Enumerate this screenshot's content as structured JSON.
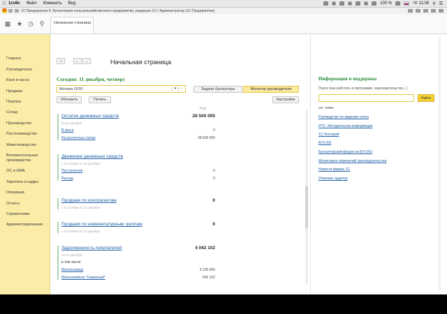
{
  "menubar": {
    "app": "1cv8c",
    "items": [
      "Файл",
      "Изменить",
      "Вид"
    ],
    "battery": "100 %",
    "clock": "Чт 11:08"
  },
  "titlebar": {
    "title": "1С:Предприятие 8. Бухгалтерия сельскохозяйственного предприятия, редакция 3.0 / Администратор (1С:Предприятие)"
  },
  "tab": {
    "label": "Начальная страница"
  },
  "sidebar": {
    "items": [
      "Главное",
      "Руководителю",
      "Банк и касса",
      "Продажи",
      "Покупки",
      "Склад",
      "Производство",
      "Растениеводство",
      "Животноводство",
      "Вспомогательные производства",
      "ОС и НМА",
      "Зарплата и кадры",
      "Операции",
      "Отчеты",
      "Справочники",
      "Администрирование"
    ]
  },
  "main": {
    "page_title": "Начальная страница",
    "today": "Сегодня: 11 декабря, четверг",
    "org": "Молоко ООО",
    "btn_tasks": "Задачи бухгалтера",
    "btn_monitor": "Монитор руководителя",
    "btn_refresh": "Обновить",
    "btn_print": "Печать",
    "btn_settings": "Настройки",
    "col_unit": "Руб",
    "blocks": {
      "cash": {
        "title": "Остатки денежных средств",
        "value": "28 500 000",
        "period": "на 11 декабря",
        "rows": [
          {
            "label": "В кассе",
            "value": "0"
          },
          {
            "label": "На расчетных счетах",
            "value": "28 500 000"
          }
        ]
      },
      "flow": {
        "title": "Движение денежных средств",
        "period": "с 10 ноября по 11 декабря",
        "rows": [
          {
            "label": "Поступления",
            "value": "0"
          },
          {
            "label": "Расход",
            "value": "0"
          }
        ]
      },
      "sales_ctr": {
        "title": "Продажи по контрагентам",
        "value": "0",
        "period": "с 12 ноября по 11 декабря"
      },
      "sales_nom": {
        "title": "Продажи по номенклатурным группам",
        "value": "0",
        "period": "с 12 ноября по 11 декабря"
      },
      "debt": {
        "title": "Задолженность покупателей",
        "value": "4 042 102",
        "period": "на 11 декабря",
        "sub": "в том числе",
        "rows": [
          {
            "label": "Молокозавод",
            "value": "3 100 000"
          },
          {
            "label": "Мясокомбинат \"Камерный\"",
            "value": "942 102"
          }
        ]
      }
    }
  },
  "support": {
    "title": "Информация и поддержка",
    "search_label": "Поиск (как работать в программе, законодательство...)",
    "find_button": "Найти",
    "see_also": "см. также",
    "links": [
      "Руководство по ведению учета",
      "ИТС. Методическая информация",
      "1С:Лекторий",
      "БУХ.RU",
      "Бухгалтерский форум на БУХ.RU",
      "Мониторинг изменений законодательства",
      "Новости фирмы 1С",
      "Отвечает аудитор"
    ]
  }
}
